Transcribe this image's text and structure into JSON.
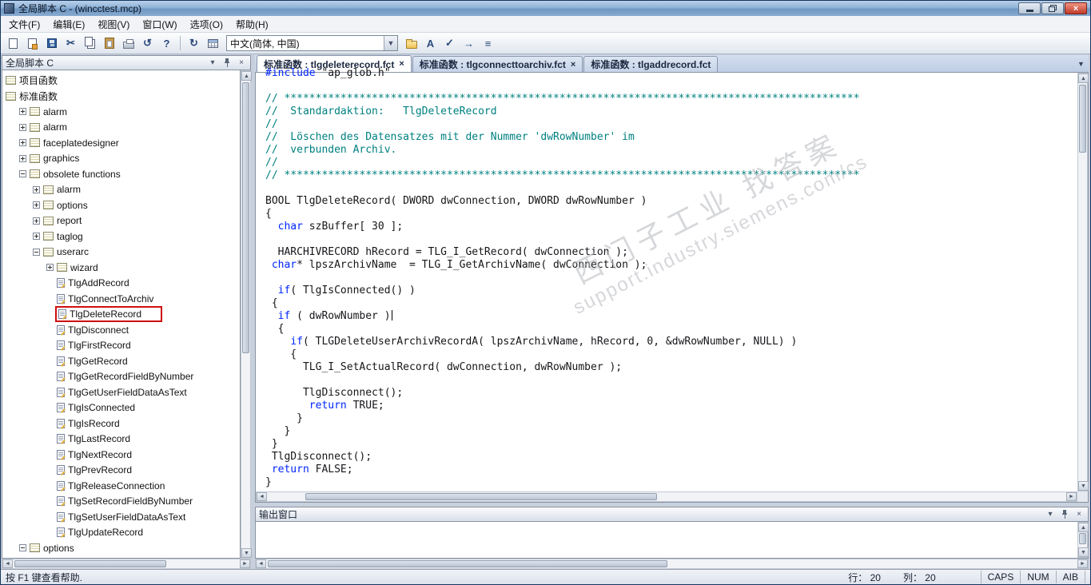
{
  "titlebar": {
    "title": "全局脚本 C - (wincctest.mcp)"
  },
  "menu": {
    "items": [
      {
        "label": "文件(F)",
        "name": "menu-file"
      },
      {
        "label": "编辑(E)",
        "name": "menu-edit"
      },
      {
        "label": "视图(V)",
        "name": "menu-view"
      },
      {
        "label": "窗口(W)",
        "name": "menu-window"
      },
      {
        "label": "选项(O)",
        "name": "menu-options"
      },
      {
        "label": "帮助(H)",
        "name": "menu-help"
      }
    ]
  },
  "toolbar": {
    "language": "中文(简体, 中国)",
    "items": [
      {
        "name": "new-file-button",
        "icon": "new-file-icon",
        "kind": "page"
      },
      {
        "name": "new-action-button",
        "icon": "new-action-icon",
        "kind": "page2"
      },
      {
        "name": "save-button",
        "icon": "save-icon",
        "kind": "save"
      },
      {
        "name": "cut-button",
        "icon": "scissors-icon",
        "kind": "glyph",
        "glyph": "✂"
      },
      {
        "name": "copy-button",
        "icon": "copy-icon",
        "kind": "copy"
      },
      {
        "name": "paste-button",
        "icon": "paste-icon",
        "kind": "paste"
      },
      {
        "name": "print-button",
        "icon": "printer-icon",
        "kind": "print"
      },
      {
        "name": "undo-button",
        "icon": "undo-arrow-icon",
        "kind": "glyph",
        "glyph": "↺"
      },
      {
        "name": "help-mode-button",
        "icon": "help-pointer-icon",
        "kind": "glyph",
        "glyph": "?"
      },
      {
        "type": "sep"
      },
      {
        "name": "update-button",
        "icon": "refresh-icon",
        "kind": "glyph",
        "glyph": "↻"
      },
      {
        "name": "table-button",
        "icon": "table-grid-icon",
        "kind": "grid"
      },
      {
        "type": "combo"
      },
      {
        "name": "open-folder-button",
        "icon": "folder-icon",
        "kind": "folder"
      },
      {
        "name": "font-button",
        "icon": "font-a-icon",
        "kind": "glyph",
        "glyph": "A"
      },
      {
        "name": "syntax-check-button",
        "icon": "check-icon",
        "kind": "glyph",
        "glyph": "✓"
      },
      {
        "name": "export-button",
        "icon": "arrow-right-icon",
        "kind": "glyph",
        "glyph": "→"
      },
      {
        "name": "properties-button",
        "icon": "properties-icon",
        "kind": "glyph",
        "glyph": "≡"
      }
    ]
  },
  "explorer": {
    "title": "全局脚本 C",
    "tree": [
      {
        "label": "项目函数",
        "level": 0,
        "icon": "stack",
        "expand": null
      },
      {
        "label": "标准函数",
        "level": 0,
        "icon": "stack",
        "expand": null
      },
      {
        "label": "alarm",
        "level": 1,
        "icon": "stack",
        "expand": "plus"
      },
      {
        "label": "alarm",
        "level": 1,
        "icon": "stack",
        "expand": "plus"
      },
      {
        "label": "faceplatedesigner",
        "level": 1,
        "icon": "stack",
        "expand": "plus"
      },
      {
        "label": "graphics",
        "level": 1,
        "icon": "stack",
        "expand": "plus"
      },
      {
        "label": "obsolete functions",
        "level": 1,
        "icon": "stack",
        "expand": "minus"
      },
      {
        "label": "alarm",
        "level": 2,
        "icon": "stack",
        "expand": "plus"
      },
      {
        "label": "options",
        "level": 2,
        "icon": "stack",
        "expand": "plus"
      },
      {
        "label": "report",
        "level": 2,
        "icon": "stack",
        "expand": "plus"
      },
      {
        "label": "taglog",
        "level": 2,
        "icon": "stack",
        "expand": "plus"
      },
      {
        "label": "userarc",
        "level": 2,
        "icon": "stack",
        "expand": "minus"
      },
      {
        "label": "wizard",
        "level": 3,
        "icon": "stack",
        "expand": "plus"
      },
      {
        "label": "TlgAddRecord",
        "level": 3,
        "icon": "script",
        "expand": null
      },
      {
        "label": "TlgConnectToArchiv",
        "level": 3,
        "icon": "script",
        "expand": null
      },
      {
        "label": "TlgDeleteRecord",
        "level": 3,
        "icon": "script",
        "expand": null,
        "highlight": true
      },
      {
        "label": "TlgDisconnect",
        "level": 3,
        "icon": "script",
        "expand": null
      },
      {
        "label": "TlgFirstRecord",
        "level": 3,
        "icon": "script",
        "expand": null
      },
      {
        "label": "TlgGetRecord",
        "level": 3,
        "icon": "script",
        "expand": null
      },
      {
        "label": "TlgGetRecordFieldByNumber",
        "level": 3,
        "icon": "script",
        "expand": null
      },
      {
        "label": "TlgGetUserFieldDataAsText",
        "level": 3,
        "icon": "script",
        "expand": null
      },
      {
        "label": "TlgIsConnected",
        "level": 3,
        "icon": "script",
        "expand": null
      },
      {
        "label": "TlgIsRecord",
        "level": 3,
        "icon": "script",
        "expand": null
      },
      {
        "label": "TlgLastRecord",
        "level": 3,
        "icon": "script",
        "expand": null
      },
      {
        "label": "TlgNextRecord",
        "level": 3,
        "icon": "script",
        "expand": null
      },
      {
        "label": "TlgPrevRecord",
        "level": 3,
        "icon": "script",
        "expand": null
      },
      {
        "label": "TlgReleaseConnection",
        "level": 3,
        "icon": "script",
        "expand": null
      },
      {
        "label": "TlgSetRecordFieldByNumber",
        "level": 3,
        "icon": "script",
        "expand": null
      },
      {
        "label": "TlgSetUserFieldDataAsText",
        "level": 3,
        "icon": "script",
        "expand": null
      },
      {
        "label": "TlgUpdateRecord",
        "level": 3,
        "icon": "script",
        "expand": null
      },
      {
        "label": "options",
        "level": 1,
        "icon": "stack",
        "expand": "minus"
      },
      {
        "label": "",
        "level": 2,
        "icon": "script",
        "expand": "plus"
      }
    ]
  },
  "tabs": [
    {
      "label": "标准函数 : tlgdeleterecord.fct",
      "name": "tab-tlgdeleterecord",
      "active": true,
      "close": true
    },
    {
      "label": "标准函数 : tlgconnecttoarchiv.fct",
      "name": "tab-tlgconnecttoarchiv",
      "active": false,
      "close": true
    },
    {
      "label": "标准函数 : tlgaddrecord.fct",
      "name": "tab-tlgaddrecord",
      "active": false,
      "close": false
    }
  ],
  "editor": {
    "caret_line": 19,
    "lines": [
      [
        [
          "#include ",
          "k"
        ],
        [
          "\"ap_glob.h\"",
          "p"
        ]
      ],
      [],
      [
        [
          "// ********************************************************************************************",
          "c"
        ]
      ],
      [
        [
          "//  Standardaktion:   TlgDeleteRecord",
          "c"
        ]
      ],
      [
        [
          "//",
          "c"
        ]
      ],
      [
        [
          "//  Löschen des Datensatzes mit der Nummer 'dwRowNumber' im",
          "c"
        ]
      ],
      [
        [
          "//  verbunden Archiv.",
          "c"
        ]
      ],
      [
        [
          "//",
          "c"
        ]
      ],
      [
        [
          "// ********************************************************************************************",
          "c"
        ]
      ],
      [],
      [
        [
          "BOOL TlgDeleteRecord( DWORD dwConnection, DWORD dwRowNumber )",
          "p"
        ]
      ],
      [
        [
          "{",
          "p"
        ]
      ],
      [
        [
          "  ",
          "p"
        ],
        [
          "char",
          "k"
        ],
        [
          " szBuffer[ 30 ];",
          "p"
        ]
      ],
      [],
      [
        [
          "  HARCHIVRECORD hRecord = TLG_I_GetRecord( dwConnection );",
          "p"
        ]
      ],
      [
        [
          " ",
          "p"
        ],
        [
          "char",
          "k"
        ],
        [
          "* lpszArchivName  = TLG_I_GetArchivName( dwConnection );",
          "p"
        ]
      ],
      [],
      [
        [
          "  ",
          "p"
        ],
        [
          "if",
          "k"
        ],
        [
          "( TlgIsConnected() )",
          "p"
        ]
      ],
      [
        [
          " {",
          "p"
        ]
      ],
      [
        [
          "  ",
          "p"
        ],
        [
          "if",
          "k"
        ],
        [
          " ( dwRowNumber )",
          "p"
        ]
      ],
      [
        [
          "  {",
          "p"
        ]
      ],
      [
        [
          "    ",
          "p"
        ],
        [
          "if",
          "k"
        ],
        [
          "( TLGDeleteUserArchivRecordA( lpszArchivName, hRecord, 0, &dwRowNumber, NULL) )",
          "p"
        ]
      ],
      [
        [
          "    {",
          "p"
        ]
      ],
      [
        [
          "      TLG_I_SetActualRecord( dwConnection, dwRowNumber );",
          "p"
        ]
      ],
      [],
      [
        [
          "      TlgDisconnect();",
          "p"
        ]
      ],
      [
        [
          "       ",
          "p"
        ],
        [
          "return",
          "k"
        ],
        [
          " TRUE;",
          "p"
        ]
      ],
      [
        [
          "     }",
          "p"
        ]
      ],
      [
        [
          "   }",
          "p"
        ]
      ],
      [
        [
          " }",
          "p"
        ]
      ],
      [
        [
          " TlgDisconnect();",
          "p"
        ]
      ],
      [
        [
          " ",
          "p"
        ],
        [
          "return",
          "k"
        ],
        [
          " FALSE;",
          "p"
        ]
      ],
      [
        [
          "}",
          "p"
        ]
      ]
    ]
  },
  "watermark": {
    "line1": "西门子工业 找答案",
    "line2": "support.industry.siemens.com/cs"
  },
  "output": {
    "title": "输出窗口"
  },
  "statusbar": {
    "help": "按 F1 键查看帮助.",
    "line": "行： 20",
    "col": "列： 20",
    "flags": [
      {
        "label": "CAPS",
        "name": "caps-indicator"
      },
      {
        "label": "NUM",
        "name": "num-indicator"
      },
      {
        "label": "AIB",
        "name": "overwrite-indicator"
      }
    ]
  }
}
